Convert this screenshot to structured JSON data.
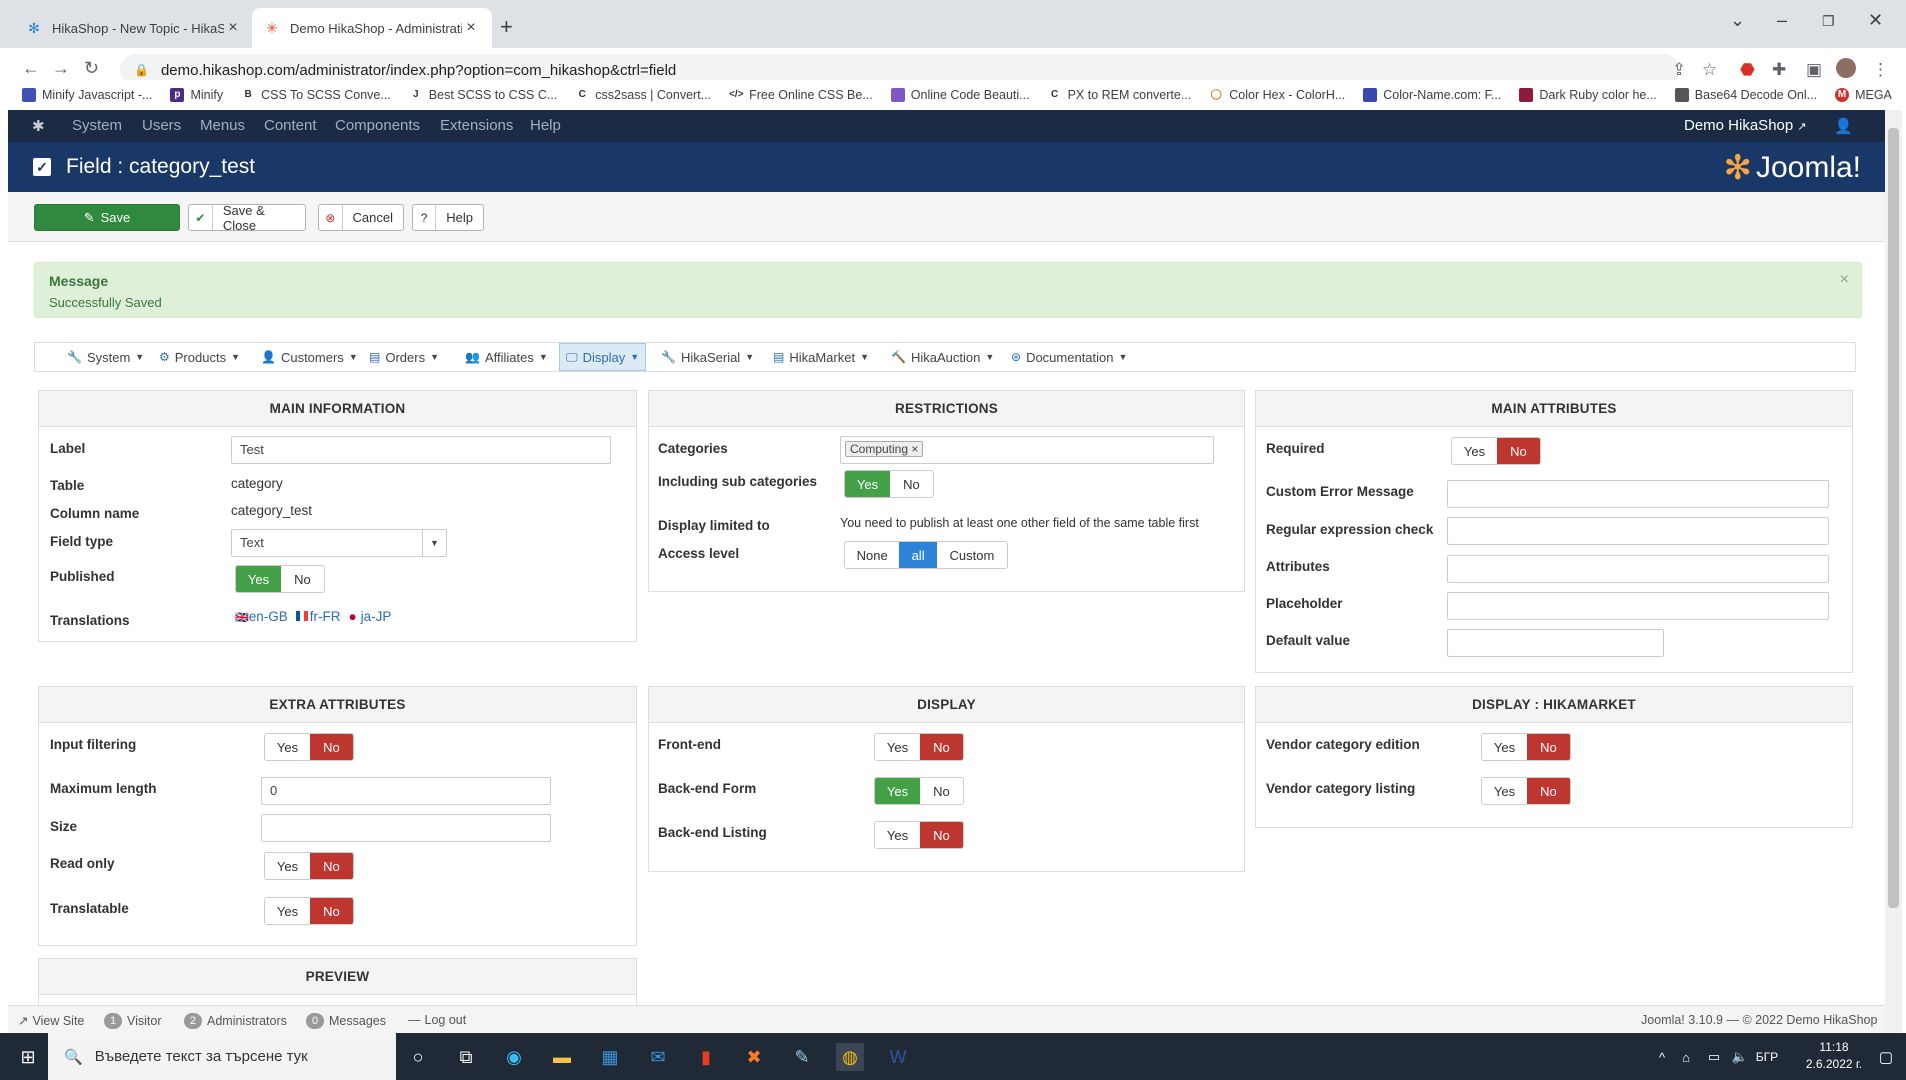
{
  "browser": {
    "tabs": [
      {
        "title": "HikaShop - New Topic - HikaSho"
      },
      {
        "title": "Demo HikaShop - Administration"
      }
    ],
    "url": "demo.hikashop.com/administrator/index.php?option=com_hikashop&ctrl=field",
    "bookmarks": [
      "Minify Javascript -...",
      "Minify",
      "CSS To SCSS Conve...",
      "Best SCSS to CSS C...",
      "css2sass | Convert...",
      "Free Online CSS Be...",
      "Online Code Beauti...",
      "PX to REM converte...",
      "Color Hex - ColorH...",
      "Color-Name.com: F...",
      "Dark Ruby color he...",
      "Base64 Decode Onl...",
      "MEGA"
    ]
  },
  "joomla": {
    "menu": [
      "System",
      "Users",
      "Menus",
      "Content",
      "Components",
      "Extensions",
      "Help"
    ],
    "site_name": "Demo HikaShop",
    "page_title": "Field : category_test",
    "logo_text": "Joomla!"
  },
  "toolbar": {
    "save": "Save",
    "save_close": "Save & Close",
    "cancel": "Cancel",
    "help": "Help"
  },
  "message": {
    "heading": "Message",
    "text": "Successfully Saved",
    "close": "×"
  },
  "hika_menu": [
    "System",
    "Products",
    "Customers",
    "Orders",
    "Affiliates",
    "Display",
    "HikaSerial",
    "HikaMarket",
    "HikaAuction",
    "Documentation"
  ],
  "main_info": {
    "heading": "MAIN INFORMATION",
    "label_l": "Label",
    "label_v": "Test",
    "table_l": "Table",
    "table_v": "category",
    "column_l": "Column name",
    "column_v": "category_test",
    "fieldtype_l": "Field type",
    "fieldtype_v": "Text",
    "published_l": "Published",
    "translations_l": "Translations",
    "translations": [
      "en-GB",
      "fr-FR",
      "ja-JP"
    ]
  },
  "restrictions": {
    "heading": "RESTRICTIONS",
    "categories_l": "Categories",
    "category_tag": "Computing",
    "subcats_l": "Including sub categories",
    "display_limited_l": "Display limited to",
    "display_limited_v": "You need to publish at least one other field of the same table first",
    "access_l": "Access level",
    "access_options": [
      "None",
      "all",
      "Custom"
    ]
  },
  "main_attributes": {
    "heading": "MAIN ATTRIBUTES",
    "required_l": "Required",
    "custom_error_l": "Custom Error Message",
    "regex_l": "Regular expression check",
    "attributes_l": "Attributes",
    "placeholder_l": "Placeholder",
    "default_l": "Default value"
  },
  "extra_attributes": {
    "heading": "EXTRA ATTRIBUTES",
    "input_filtering_l": "Input filtering",
    "max_length_l": "Maximum length",
    "max_length_v": "0",
    "size_l": "Size",
    "read_only_l": "Read only",
    "translatable_l": "Translatable"
  },
  "display": {
    "heading": "DISPLAY",
    "frontend_l": "Front-end",
    "backend_form_l": "Back-end Form",
    "backend_listing_l": "Back-end Listing"
  },
  "display_hikamarket": {
    "heading": "DISPLAY : HIKAMARKET",
    "vendor_edition_l": "Vendor category edition",
    "vendor_listing_l": "Vendor category listing"
  },
  "preview": {
    "heading": "PREVIEW"
  },
  "yes": "Yes",
  "no": "No",
  "status": {
    "view_site": "View Site",
    "visitor_count": "1",
    "visitor": "Visitor",
    "admin_count": "2",
    "administrators": "Administrators",
    "msg_count": "0",
    "messages": "Messages",
    "logout": "Log out",
    "footer": "Joomla! 3.10.9 — © 2022 Demo HikaShop"
  },
  "taskbar": {
    "search_placeholder": "Въведете текст за търсене тук",
    "lang": "БГР",
    "time": "11:18",
    "date": "2.6.2022 г."
  }
}
